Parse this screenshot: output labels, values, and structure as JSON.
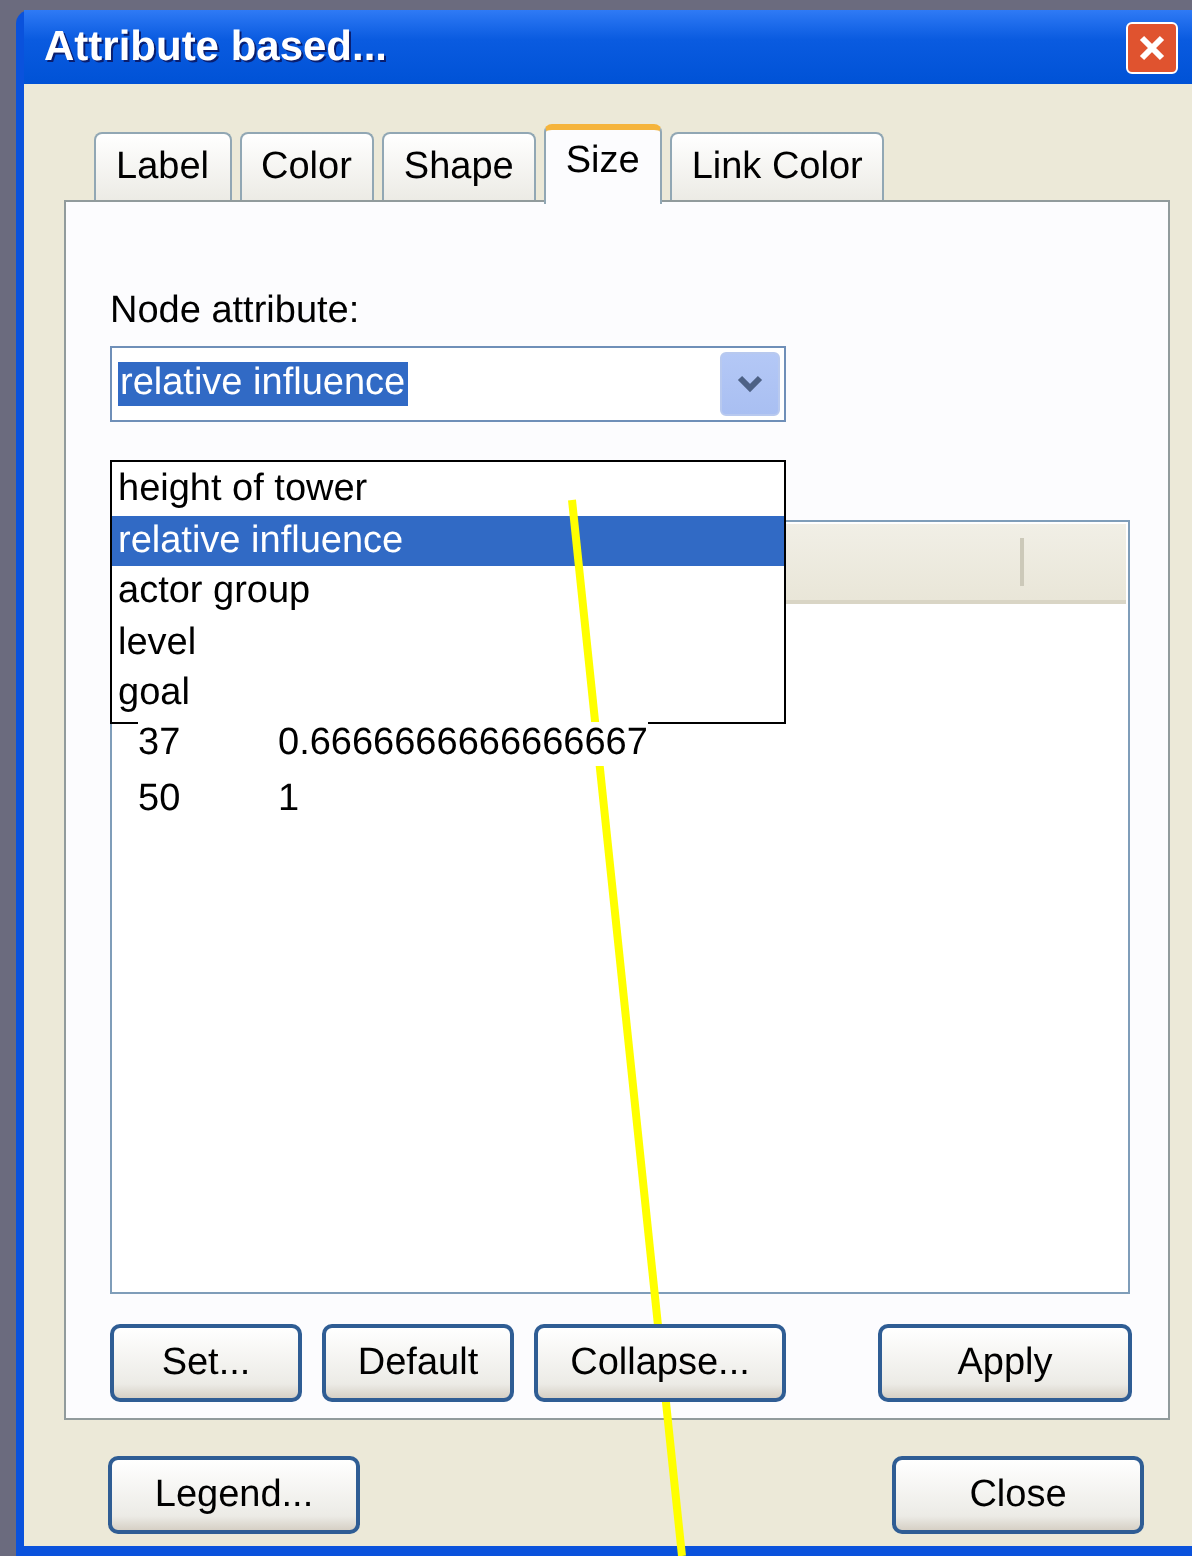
{
  "window": {
    "title": "Attribute based..."
  },
  "tabs": [
    {
      "label": "Label",
      "selected": false
    },
    {
      "label": "Color",
      "selected": false
    },
    {
      "label": "Shape",
      "selected": false
    },
    {
      "label": "Size",
      "selected": true
    },
    {
      "label": "Link Color",
      "selected": false
    }
  ],
  "node_attribute": {
    "label": "Node attribute:",
    "value": "relative influence",
    "expanded": true,
    "options": [
      {
        "label": "height of tower",
        "selected": false
      },
      {
        "label": "relative influence",
        "selected": true
      },
      {
        "label": "actor group",
        "selected": false
      },
      {
        "label": "level",
        "selected": false
      },
      {
        "label": "goal",
        "selected": false
      }
    ]
  },
  "table": {
    "rows": [
      [
        "37",
        "0.6666666666666667"
      ],
      [
        "50",
        "1"
      ]
    ]
  },
  "panel_buttons": [
    "Set...",
    "Default",
    "Collapse...",
    "Apply"
  ],
  "footer_buttons": [
    "Legend...",
    "Close"
  ]
}
